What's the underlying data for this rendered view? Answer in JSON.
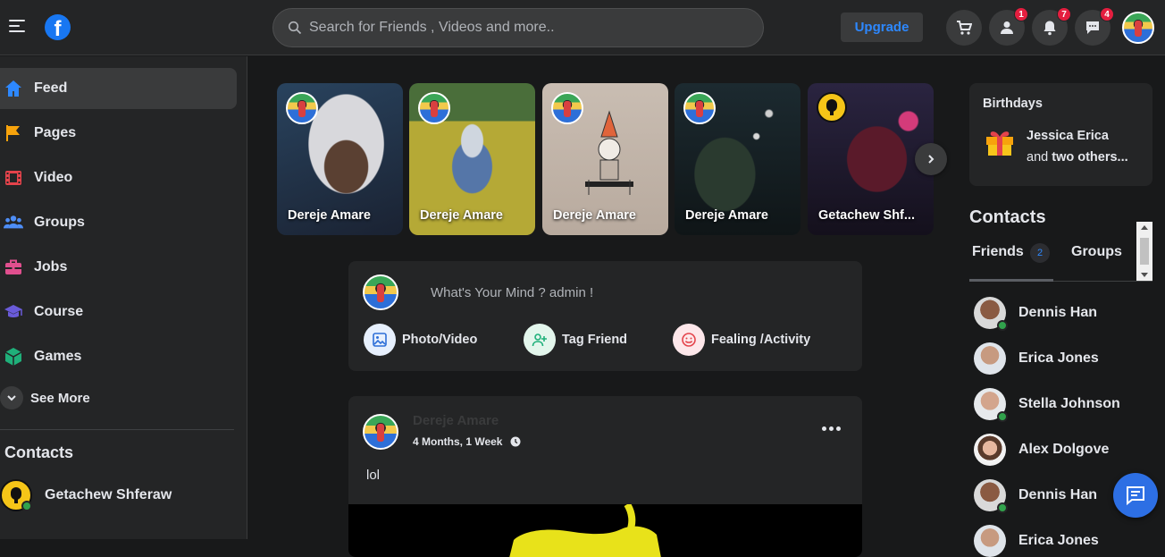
{
  "search": {
    "placeholder": "Search for Friends , Videos and more.."
  },
  "topbar": {
    "upgrade_label": "Upgrade",
    "badges": {
      "friends": "1",
      "notifications": "7",
      "messages": "4"
    }
  },
  "sidebar": {
    "items": [
      {
        "label": "Feed",
        "icon": "home-icon",
        "color": "#2d88ff"
      },
      {
        "label": "Pages",
        "icon": "flag-icon",
        "color": "#f7a30c"
      },
      {
        "label": "Video",
        "icon": "film-icon",
        "color": "#e4434b"
      },
      {
        "label": "Groups",
        "icon": "groups-icon",
        "color": "#4e8ef7"
      },
      {
        "label": "Jobs",
        "icon": "briefcase-icon",
        "color": "#e04f8e"
      },
      {
        "label": "Course",
        "icon": "graduation-cap-icon",
        "color": "#6a5bd9"
      },
      {
        "label": "Games",
        "icon": "cube-icon",
        "color": "#1fb07a"
      }
    ],
    "see_more": "See More",
    "contacts_heading": "Contacts",
    "contacts": [
      {
        "name": "Getachew Shferaw"
      }
    ]
  },
  "stories": [
    {
      "name": "Dereje Amare"
    },
    {
      "name": "Dereje Amare"
    },
    {
      "name": "Dereje Amare"
    },
    {
      "name": "Dereje Amare"
    },
    {
      "name": "Getachew Shf..."
    }
  ],
  "composer": {
    "prompt": "What's Your Mind ? admin !",
    "actions": [
      {
        "label": "Photo/Video",
        "icon": "image-icon"
      },
      {
        "label": "Tag Friend",
        "icon": "person-add-icon"
      },
      {
        "label": "Fealing /Activity",
        "icon": "smile-icon"
      }
    ]
  },
  "post": {
    "author": "Dereje Amare",
    "time": "4 Months, 1 Week",
    "text": "lol"
  },
  "rightbar": {
    "birthdays": {
      "heading": "Birthdays",
      "name": "Jessica Erica",
      "and_text": "and",
      "others": "two others..."
    },
    "contacts_heading": "Contacts",
    "tabs": {
      "friends": "Friends",
      "friends_count": "2",
      "groups": "Groups"
    },
    "contacts": [
      {
        "name": "Dennis Han",
        "online": true
      },
      {
        "name": "Erica Jones",
        "online": false
      },
      {
        "name": "Stella Johnson",
        "online": true
      },
      {
        "name": "Alex Dolgove",
        "online": false
      },
      {
        "name": "Dennis Han",
        "online": true
      },
      {
        "name": "Erica Jones",
        "online": false
      }
    ]
  }
}
